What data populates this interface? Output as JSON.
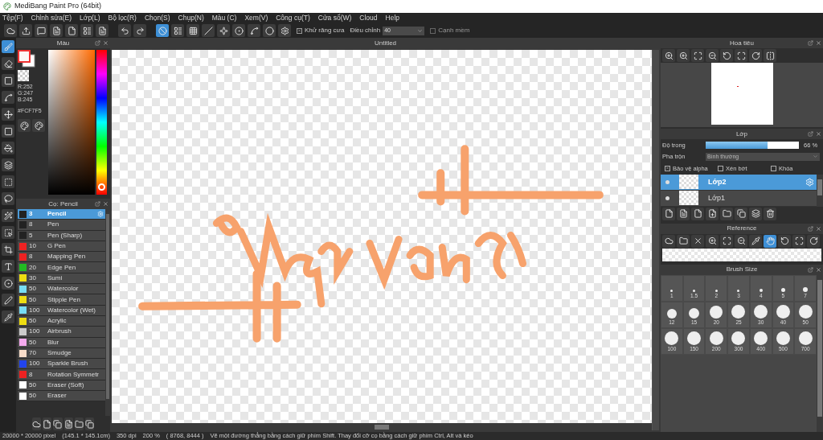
{
  "window": {
    "title": "MediBang Paint Pro (64bit)"
  },
  "menu": [
    "Tệp(F)",
    "Chỉnh sửa(E)",
    "Lớp(L)",
    "Bộ lọc(R)",
    "Chọn(S)",
    "Chụp(N)",
    "Màu (C)",
    "Xem(V)",
    "Công cụ(T)",
    "Cửa sổ(W)",
    "Cloud",
    "Help"
  ],
  "toolbar": {
    "snaps": [
      {
        "selected": true
      },
      {
        "selected": false
      },
      {
        "selected": false
      },
      {
        "selected": false
      },
      {
        "selected": false
      },
      {
        "selected": false
      },
      {
        "selected": false
      },
      {
        "selected": false
      },
      {
        "selected": false
      }
    ],
    "antialias": {
      "label": "Khử răng cưa",
      "checked": true
    },
    "adjust": {
      "label": "Điều chỉnh",
      "value": "40"
    },
    "soft_edge": {
      "label": "Cạnh mềm",
      "checked": false
    }
  },
  "tools": [
    {
      "selected": true
    },
    {
      "selected": false
    },
    {
      "selected": false
    },
    {
      "selected": false
    },
    {
      "selected": false
    },
    {
      "selected": false
    },
    {
      "selected": false
    },
    {
      "selected": false
    },
    {
      "selected": false
    },
    {
      "selected": false
    },
    {
      "selected": false
    },
    {
      "selected": false
    },
    {
      "selected": false
    },
    {
      "selected": false
    },
    {
      "selected": false
    },
    {
      "selected": false
    },
    {
      "selected": false
    }
  ],
  "color_panel": {
    "title": "Màu",
    "readings": [
      "R:252",
      "G:247",
      "B:245"
    ],
    "hex": "#FCF7F5",
    "hue": {
      "level": 0.03
    }
  },
  "brush_panel": {
    "title": "Cọ: Pencil",
    "brushes": [
      {
        "size": "3",
        "name": "Pencil",
        "color": "#222222",
        "selected": true
      },
      {
        "size": "8",
        "name": "Pen",
        "color": "#222222",
        "selected": false
      },
      {
        "size": "5",
        "name": "Pen (Sharp)",
        "color": "#222222",
        "selected": false
      },
      {
        "size": "10",
        "name": "G Pen",
        "color": "#ee2222",
        "selected": false
      },
      {
        "size": "8",
        "name": "Mapping Pen",
        "color": "#ee2222",
        "selected": false
      },
      {
        "size": "20",
        "name": "Edge Pen",
        "color": "#22bb22",
        "selected": false
      },
      {
        "size": "30",
        "name": "Sumi",
        "color": "#eedd11",
        "selected": false
      },
      {
        "size": "50",
        "name": "Watercolor",
        "color": "#77ddf5",
        "selected": false
      },
      {
        "size": "50",
        "name": "Stipple Pen",
        "color": "#eedd11",
        "selected": false
      },
      {
        "size": "100",
        "name": "Watercolor (Wet)",
        "color": "#77ddf5",
        "selected": false
      },
      {
        "size": "50",
        "name": "Acrylic",
        "color": "#eedd11",
        "selected": false
      },
      {
        "size": "100",
        "name": "Airbrush",
        "color": "#cccccc",
        "selected": false
      },
      {
        "size": "50",
        "name": "Blur",
        "color": "#f5aaee",
        "selected": false
      },
      {
        "size": "70",
        "name": "Smudge",
        "color": "#f8dcc8",
        "selected": false
      },
      {
        "size": "100",
        "name": "Sparkle Brush",
        "color": "#2244ee",
        "selected": false
      },
      {
        "size": "8",
        "name": "Rotation Symmetr",
        "color": "#ee2222",
        "selected": false
      },
      {
        "size": "50",
        "name": "Eraser (Soft)",
        "color": "#ffffff",
        "selected": false
      },
      {
        "size": "50",
        "name": "Eraser",
        "color": "#ffffff",
        "selected": false
      }
    ]
  },
  "canvas": {
    "title": "Untitled"
  },
  "navigator": {
    "title": "Hoa tiêu"
  },
  "layer_panel": {
    "title": "Lớp",
    "opacity_label": "Độ trong",
    "level": 0.66,
    "reading": "66 %",
    "blend_label": "Pha trộn",
    "blend_value": "Bình thường",
    "options": [
      {
        "label": "Bảo vệ alpha",
        "checked": true
      },
      {
        "label": "Xén bớt",
        "checked": false
      },
      {
        "label": "Khóa",
        "checked": false
      }
    ],
    "layers": [
      {
        "name": "Lớp2",
        "selected": true
      },
      {
        "name": "Lớp1",
        "selected": false
      }
    ]
  },
  "reference": {
    "title": "Reference"
  },
  "brush_size": {
    "title": "Brush Size",
    "sizes": [
      "1",
      "1.5",
      "2",
      "3",
      "4",
      "5",
      "7",
      "12",
      "15",
      "20",
      "25",
      "30",
      "40",
      "50",
      "100",
      "150",
      "200",
      "300",
      "400",
      "500",
      "700"
    ]
  },
  "status_bar": [
    "20000 * 20000 pixel",
    "(145.1 * 145.1cm)",
    "350 dpi",
    "200 %",
    "( 8768, 8444 )",
    "Vẽ một đường thẳng bằng cách giữ phím Shift. Thay đổi cỡ cọ bằng cách giữ phím Ctrl, Alt và kéo"
  ]
}
